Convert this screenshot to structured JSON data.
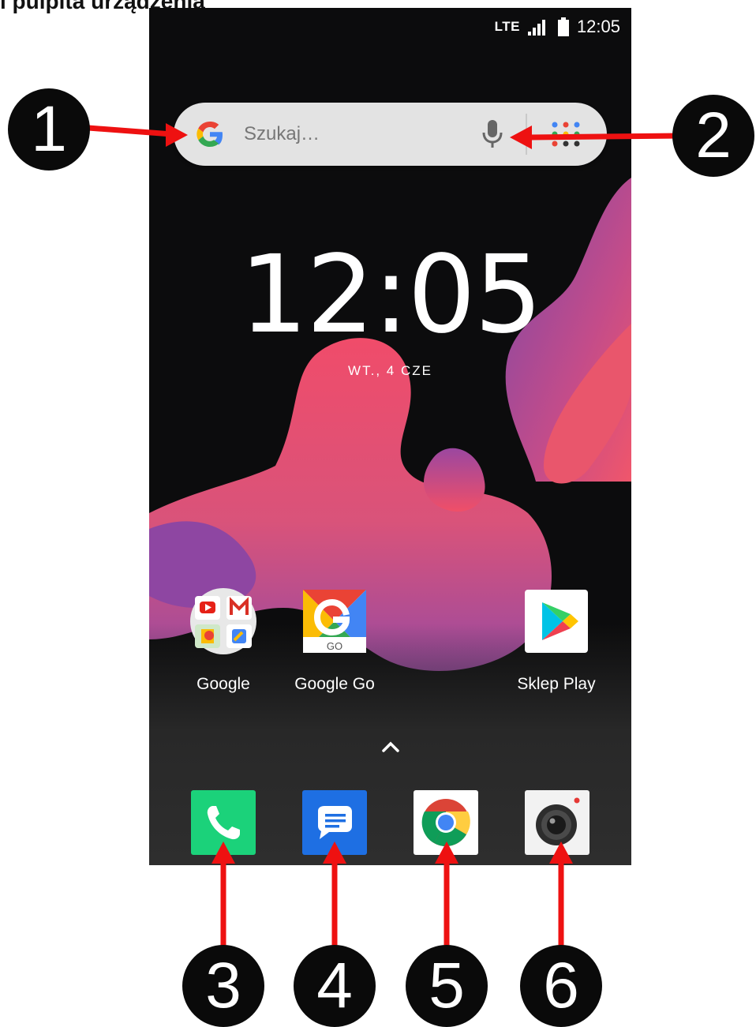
{
  "page": {
    "heading": "i pulpita urządzenia"
  },
  "statusbar": {
    "network": "LTE",
    "time": "12:05",
    "signal_icon": "signal-icon",
    "battery_icon": "battery-icon"
  },
  "search": {
    "placeholder": "Szukaj…",
    "logo_icon": "google-g-icon",
    "mic_icon": "mic-icon",
    "apps_icon": "app-dots-icon"
  },
  "clock": {
    "time": "12:05",
    "date": "WT., 4 CZE"
  },
  "home_apps": [
    {
      "label": "Google",
      "icon": "google-folder-icon"
    },
    {
      "label": "Google Go",
      "icon": "google-go-icon"
    },
    {
      "label": "Sklep Play",
      "icon": "play-store-icon"
    }
  ],
  "dock": [
    {
      "name": "Telefon",
      "icon": "phone-icon",
      "color": "#1bd27a"
    },
    {
      "name": "Wiadomości",
      "icon": "messages-icon",
      "color": "#1e6fe3"
    },
    {
      "name": "Chrome",
      "icon": "chrome-icon",
      "color": "#ffffff"
    },
    {
      "name": "Aparat",
      "icon": "camera-icon",
      "color": "#f2f2f2"
    }
  ],
  "annotations": [
    "1",
    "2",
    "3",
    "4",
    "5",
    "6"
  ],
  "colors": {
    "arrow": "#ee1111",
    "badge": "#0a0a0a",
    "wallpaper_pink": "#e9566c",
    "wallpaper_purple": "#8b4aa3"
  }
}
